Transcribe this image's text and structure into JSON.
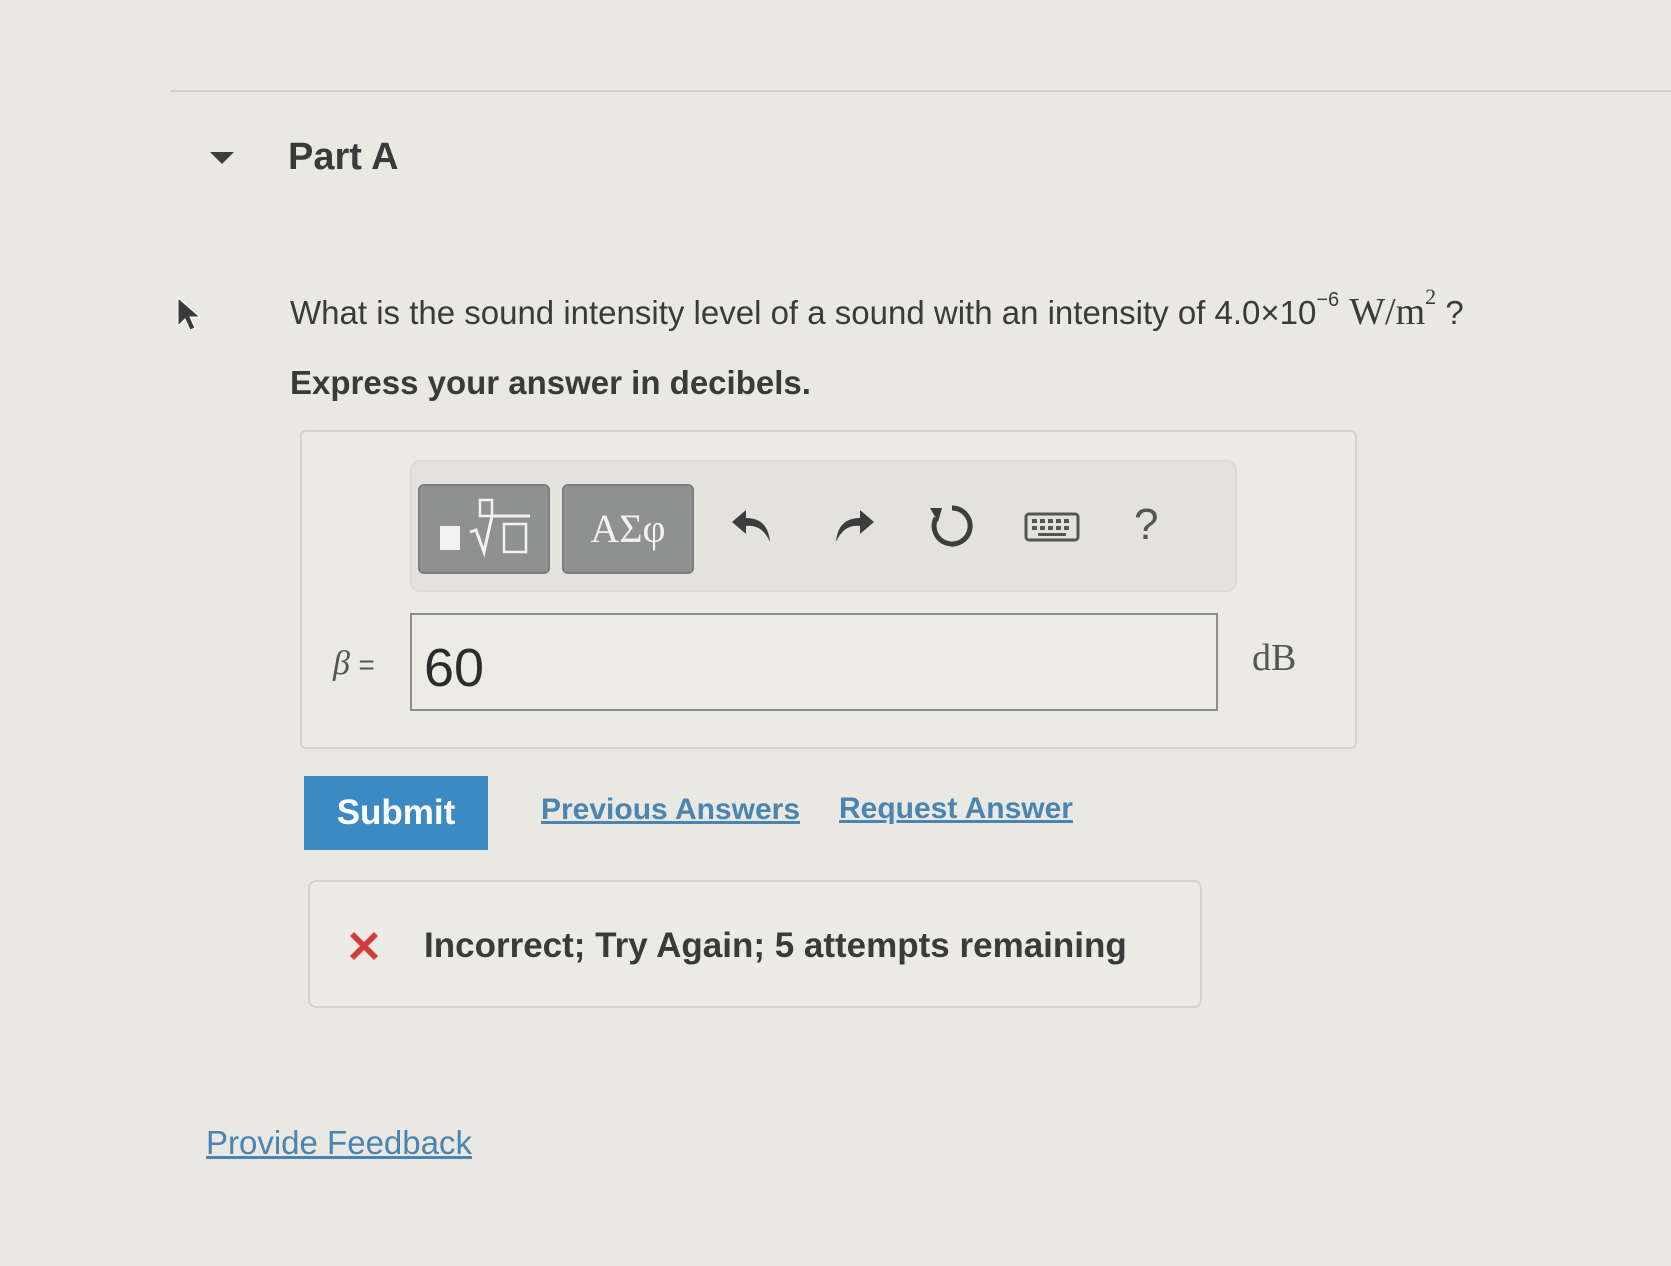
{
  "part": {
    "title": "Part A"
  },
  "question": {
    "text": "What is the sound intensity level of a sound with an intensity of ",
    "coefficient": "4.0×10",
    "exponent": "−6",
    "unit_base": "W/m",
    "unit_exponent": "2",
    "end": " ?",
    "instruction": "Express your answer in decibels."
  },
  "toolbar": {
    "templates_icon": "templates-sqrt-icon",
    "symbols_label": "ΑΣφ",
    "undo_icon": "undo-icon",
    "redo_icon": "redo-icon",
    "reset_icon": "reset-icon",
    "keyboard_icon": "keyboard-icon",
    "help_label": "?"
  },
  "answer": {
    "variable": "β",
    "equals": "=",
    "value": "60",
    "unit": "dB"
  },
  "actions": {
    "submit_label": "Submit",
    "previous_answers": "Previous Answers",
    "request_answer": "Request Answer"
  },
  "feedback": {
    "status_icon": "x-mark-icon",
    "message": "Incorrect; Try Again; 5 attempts remaining"
  },
  "footer": {
    "provide_feedback": "Provide Feedback"
  },
  "colors": {
    "accent": "#3c8ac4",
    "link": "#4a84b0",
    "error": "#d13b3b",
    "toolbar_button": "#8e9190"
  }
}
